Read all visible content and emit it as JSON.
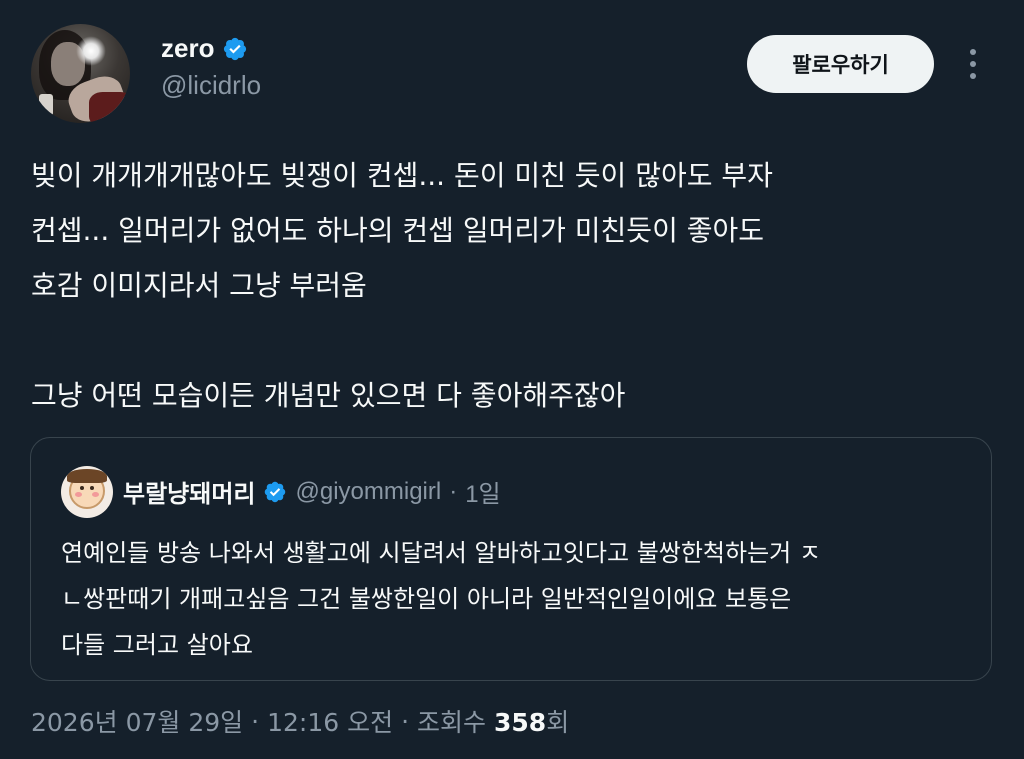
{
  "author": {
    "display_name": "zero",
    "handle": "@licidrlo",
    "verified_icon": "verified-badge-icon"
  },
  "actions": {
    "follow_label": "팔로우하기",
    "more_icon": "more-vertical-icon"
  },
  "body": {
    "lines": [
      "빚이 개개개개많아도 빚쟁이 컨셉... 돈이 미친 듯이 많아도 부자",
      "컨셉... 일머리가 없어도 하나의 컨셉 일머리가 미친듯이 좋아도",
      "호감 이미지라서 그냥 부러움",
      "그냥 어떤 모습이든 개념만 있으면 다 좋아해주잖아"
    ]
  },
  "quote": {
    "display_name": "부랄냥돼머리",
    "handle": "@giyommigirl",
    "separator": "·",
    "time": "1일",
    "lines": [
      "연예인들 방송 나와서 생활고에 시달려서 알바하고잇다고 불쌍한척하는거 ㅈ",
      "ㄴ쌍판때기 개패고싶음 그건 불쌍한일이 아니라 일반적인일이에요 보통은",
      "다들 그러고 살아요"
    ]
  },
  "meta": {
    "date": "2026년 07월 29일",
    "separator": "·",
    "time": "12:16 오전",
    "views_label": "조회수",
    "views_count": "358",
    "views_suffix": "회"
  },
  "colors": {
    "background": "#15202b",
    "text": "#f7f9f9",
    "secondary": "#8b98a5",
    "border": "#38444d",
    "verified": "#1d9bf0",
    "button_bg": "#eff3f4"
  }
}
